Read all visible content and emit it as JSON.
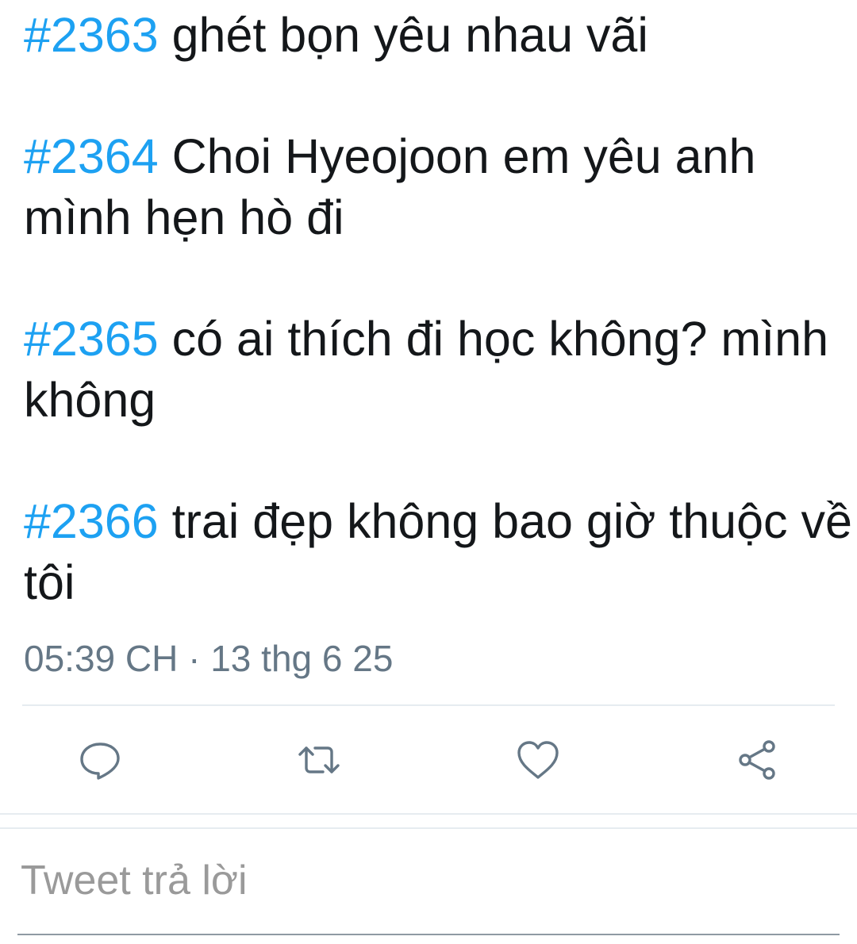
{
  "posts": [
    {
      "tag": "#2363",
      "text": "ghét bọn yêu nhau vãi"
    },
    {
      "tag": "#2364",
      "text": "Choi Hyeojoon em yêu anh mình hẹn hò đi"
    },
    {
      "tag": "#2365",
      "text": "có ai thích đi học không? mình không"
    },
    {
      "tag": "#2366",
      "text": "trai đẹp không bao giờ thuộc về tôi"
    }
  ],
  "meta": {
    "timestamp": "05:39 CH · 13 thg 6 25"
  },
  "actions": {
    "reply_icon": "speech-bubble-icon",
    "retweet_icon": "retweet-icon",
    "like_icon": "heart-icon",
    "share_icon": "share-icon",
    "icon_color": "#657786"
  },
  "reply": {
    "placeholder": "Tweet trả lời"
  },
  "colors": {
    "hashtag": "#1da1f2",
    "text": "#14171a",
    "meta": "#657786",
    "divider": "#e6ecf0"
  }
}
